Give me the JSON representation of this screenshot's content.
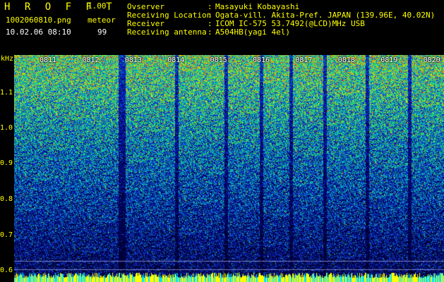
{
  "app": {
    "name": "H R O F F T",
    "version": "1.00"
  },
  "file": {
    "name": "1002060810.png",
    "timestamp": "10.02.06 08:10"
  },
  "meteor": {
    "label": "meteor",
    "count": "99"
  },
  "info": [
    {
      "label": "Ovserver",
      "value": "Masayuki Kobayashi"
    },
    {
      "label": "Receiving Location",
      "value": "Ogata-vill. Akita-Pref. JAPAN (139.96E, 40.02N)"
    },
    {
      "label": "Receiver",
      "value": "ICOM IC-575 53.7492(@LCD)MHz USB"
    },
    {
      "label": "Receiving antenna",
      "value": "A504HB(yagi 4el)"
    }
  ],
  "spectrogram": {
    "y_unit": "kHz",
    "y_ticks": [
      "1.1",
      "1.0",
      "0.9",
      "0.8",
      "0.7",
      "0.6"
    ],
    "x_ticks": [
      "0811",
      "0812",
      "0813",
      "0814",
      "0815",
      "0816",
      "0817",
      "0818",
      "0819",
      "0820"
    ],
    "colors": {
      "label_yellow": "#ffff00",
      "text_white": "#ffffff",
      "background": "#000000"
    }
  }
}
